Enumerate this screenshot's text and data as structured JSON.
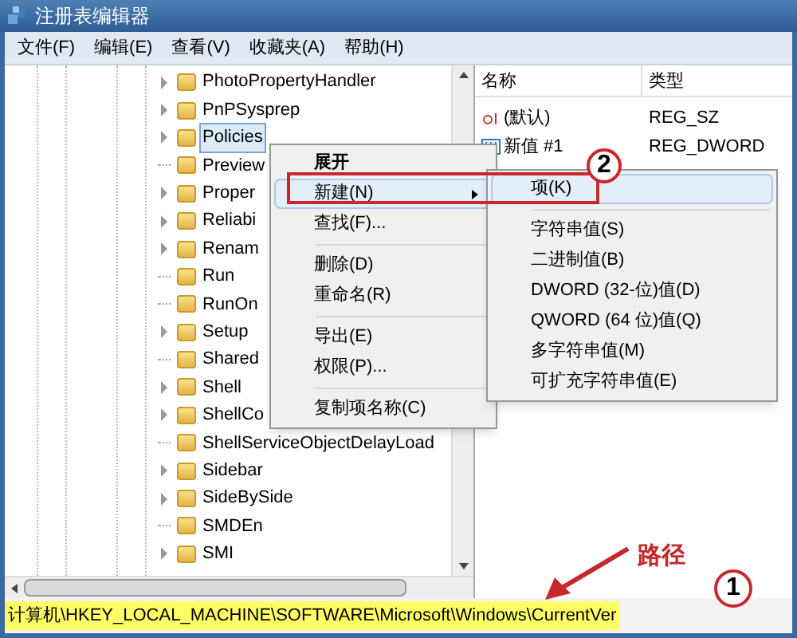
{
  "window": {
    "title": "注册表编辑器"
  },
  "menu": [
    "文件(F)",
    "编辑(E)",
    "查看(V)",
    "收藏夹(A)",
    "帮助(H)"
  ],
  "tree": [
    {
      "label": "PhotoPropertyHandler",
      "has_children": true,
      "selected": false
    },
    {
      "label": "PnPSysprep",
      "has_children": true,
      "selected": false
    },
    {
      "label": "Policies",
      "has_children": true,
      "selected": true
    },
    {
      "label": "Preview",
      "has_children": false,
      "selected": false
    },
    {
      "label": "Proper",
      "has_children": true,
      "selected": false
    },
    {
      "label": "Reliabi",
      "has_children": true,
      "selected": false
    },
    {
      "label": "Renam",
      "has_children": true,
      "selected": false
    },
    {
      "label": "Run",
      "has_children": false,
      "selected": false
    },
    {
      "label": "RunOn",
      "has_children": false,
      "selected": false
    },
    {
      "label": "Setup",
      "has_children": true,
      "selected": false
    },
    {
      "label": "Shared",
      "has_children": false,
      "selected": false
    },
    {
      "label": "Shell",
      "has_children": true,
      "selected": false
    },
    {
      "label": "ShellCo",
      "has_children": true,
      "selected": false
    },
    {
      "label": "ShellServiceObjectDelayLoad",
      "has_children": false,
      "selected": false
    },
    {
      "label": "Sidebar",
      "has_children": true,
      "selected": false
    },
    {
      "label": "SideBySide",
      "has_children": true,
      "selected": false
    },
    {
      "label": "SMDEn",
      "has_children": false,
      "selected": false
    },
    {
      "label": "SMI",
      "has_children": true,
      "selected": false
    }
  ],
  "values": {
    "columns": [
      "名称",
      "类型"
    ],
    "rows": [
      {
        "kind": "string",
        "name": "(默认)",
        "type": "REG_SZ"
      },
      {
        "kind": "dword",
        "name": "新值 #1",
        "type": "REG_DWORD"
      }
    ]
  },
  "context_menu": [
    {
      "kind": "item",
      "label": "展开",
      "bold": true,
      "submenu": false,
      "selected": false
    },
    {
      "kind": "item",
      "label": "新建(N)",
      "bold": false,
      "submenu": true,
      "selected": true
    },
    {
      "kind": "item",
      "label": "查找(F)...",
      "bold": false,
      "submenu": false,
      "selected": false
    },
    {
      "kind": "separator"
    },
    {
      "kind": "item",
      "label": "删除(D)",
      "bold": false,
      "submenu": false,
      "selected": false
    },
    {
      "kind": "item",
      "label": "重命名(R)",
      "bold": false,
      "submenu": false,
      "selected": false
    },
    {
      "kind": "separator"
    },
    {
      "kind": "item",
      "label": "导出(E)",
      "bold": false,
      "submenu": false,
      "selected": false
    },
    {
      "kind": "item",
      "label": "权限(P)...",
      "bold": false,
      "submenu": false,
      "selected": false
    },
    {
      "kind": "separator"
    },
    {
      "kind": "item",
      "label": "复制项名称(C)",
      "bold": false,
      "submenu": false,
      "selected": false
    }
  ],
  "submenu": [
    {
      "kind": "item",
      "label": "项(K)",
      "selected": true
    },
    {
      "kind": "separator"
    },
    {
      "kind": "item",
      "label": "字符串值(S)",
      "selected": false
    },
    {
      "kind": "item",
      "label": "二进制值(B)",
      "selected": false
    },
    {
      "kind": "item",
      "label": "DWORD (32-位)值(D)",
      "selected": false
    },
    {
      "kind": "item",
      "label": "QWORD (64 位)值(Q)",
      "selected": false
    },
    {
      "kind": "item",
      "label": "多字符串值(M)",
      "selected": false
    },
    {
      "kind": "item",
      "label": "可扩充字符串值(E)",
      "selected": false
    }
  ],
  "status_bar": "计算机\\HKEY_LOCAL_MACHINE\\SOFTWARE\\Microsoft\\Windows\\CurrentVer",
  "annotations": {
    "step_2": "2",
    "path_label": "路径",
    "step_1": "1"
  }
}
